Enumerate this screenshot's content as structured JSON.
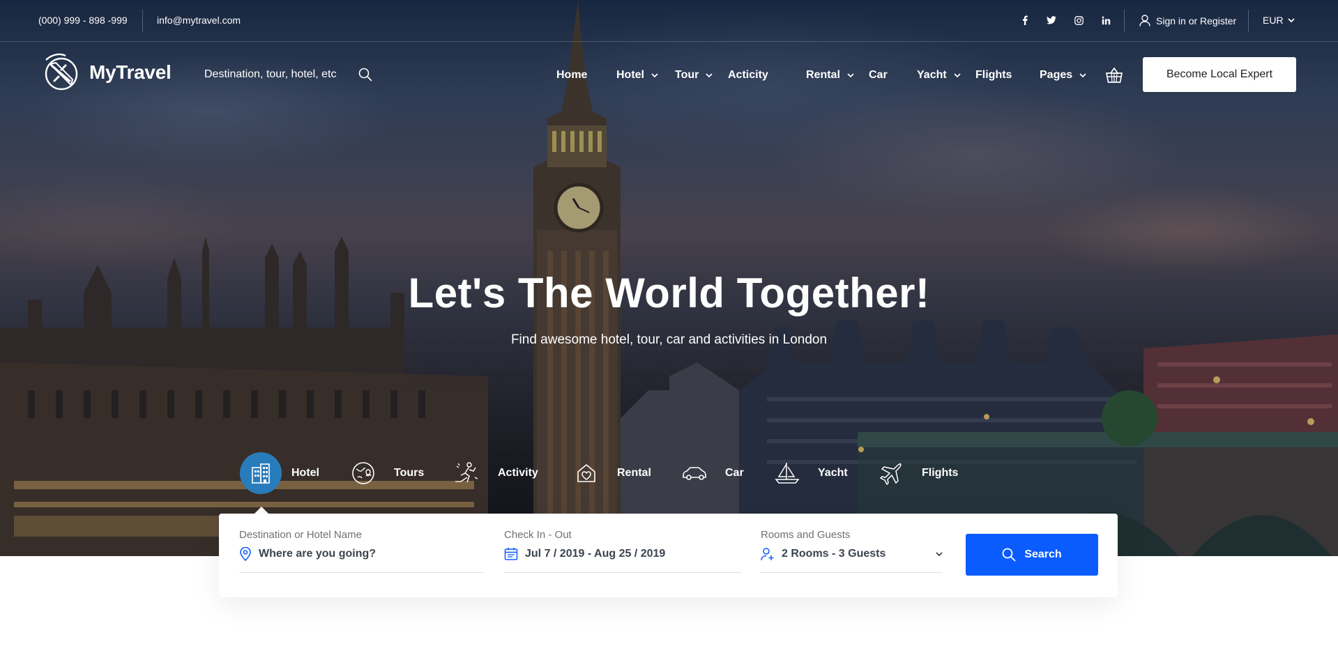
{
  "topbar": {
    "phone": "(000) 999 - 898 -999",
    "email": "info@mytravel.com",
    "social_icons": [
      "facebook-icon",
      "twitter-icon",
      "instagram-icon",
      "linkedin-icon"
    ],
    "signin_label": "Sign in or Register",
    "currency": "EUR"
  },
  "header": {
    "brand": "MyTravel",
    "search_placeholder": "Destination, tour, hotel, etc",
    "nav": [
      {
        "label": "Home",
        "dropdown": false
      },
      {
        "label": "Hotel",
        "dropdown": true
      },
      {
        "label": "Tour",
        "dropdown": true
      },
      {
        "label": "Acticity",
        "dropdown": false
      },
      {
        "label": "Rental",
        "dropdown": true
      },
      {
        "label": "Car",
        "dropdown": false
      },
      {
        "label": "Yacht",
        "dropdown": true
      },
      {
        "label": "Flights",
        "dropdown": false
      },
      {
        "label": "Pages",
        "dropdown": true
      }
    ],
    "cta_label": "Become Local Expert"
  },
  "hero": {
    "title": "Let's The World Together!",
    "subtitle": "Find awesome hotel, tour, car and activities in London"
  },
  "tabs": [
    {
      "label": "Hotel",
      "icon": "hotel-icon",
      "active": true
    },
    {
      "label": "Tours",
      "icon": "tours-icon",
      "active": false
    },
    {
      "label": "Activity",
      "icon": "activity-icon",
      "active": false
    },
    {
      "label": "Rental",
      "icon": "rental-icon",
      "active": false
    },
    {
      "label": "Car",
      "icon": "car-icon",
      "active": false
    },
    {
      "label": "Yacht",
      "icon": "yacht-icon",
      "active": false
    },
    {
      "label": "Flights",
      "icon": "flights-icon",
      "active": false
    }
  ],
  "search_form": {
    "destination": {
      "label": "Destination or Hotel Name",
      "placeholder": "Where are you going?"
    },
    "dates": {
      "label": "Check In - Out",
      "value": "Jul 7 / 2019 - Aug 25 / 2019"
    },
    "guests": {
      "label": "Rooms and Guests",
      "value": "2 Rooms - 3 Guests"
    },
    "submit_label": "Search"
  },
  "colors": {
    "accent": "#0b5cff",
    "active_tab": "#297cbb",
    "field_text": "#3b444f",
    "label_text": "#6f7074"
  }
}
